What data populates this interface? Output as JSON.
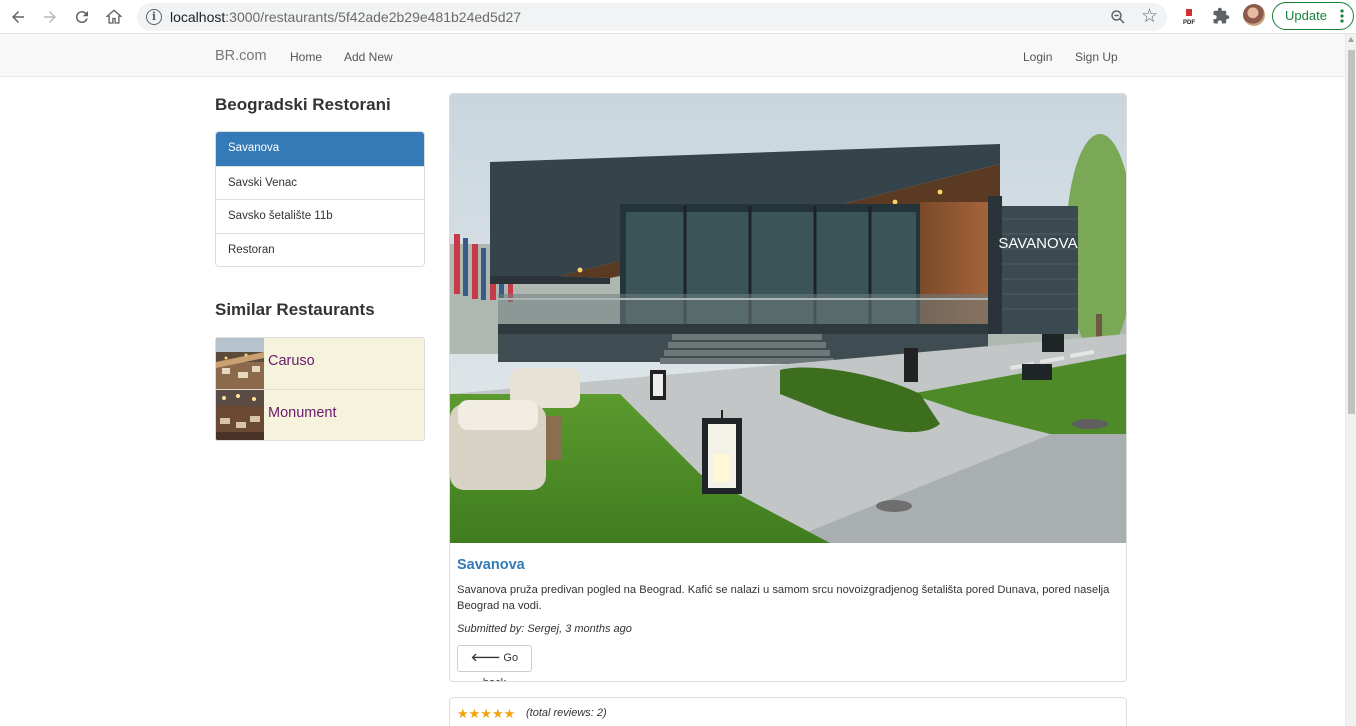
{
  "browser": {
    "url_host": "localhost",
    "url_path": ":3000/restaurants/5f42ade2b29e481b24ed5d27",
    "update_label": "Update"
  },
  "navbar": {
    "brand": "BR.com",
    "links": [
      "Home",
      "Add New"
    ],
    "login": "Login",
    "signup": "Sign Up"
  },
  "sidebar": {
    "title": "Beogradski Restorani",
    "items": [
      {
        "label": "Savanova",
        "active": true
      },
      {
        "label": "Savski Venac",
        "active": false
      },
      {
        "label": "Savsko šetalište 11b",
        "active": false
      },
      {
        "label": "Restoran",
        "active": false
      }
    ]
  },
  "similar": {
    "title": "Similar Restaurants",
    "items": [
      {
        "name": "Caruso"
      },
      {
        "name": "Monument"
      }
    ]
  },
  "restaurant": {
    "name": "Savanova",
    "description": "Savanova pruža predivan pogled na Beograd. Kafić se nalazi u samom srcu novoizgradjenog šetališta pored Dunava, pored naselja Beograd na vodi.",
    "submitted_by": "Submitted by: Sergej, 3 months ago",
    "go_back": "Go back",
    "sign_text": "SAVANOVA"
  },
  "reviews": {
    "stars": "★★★★★",
    "rating": 5,
    "total_text": "(total reviews: 2)"
  },
  "colors": {
    "active": "#337ab7",
    "similar_bg": "#f5f3dc",
    "similar_link": "#6a1b6e",
    "star": "#f0a30a"
  }
}
